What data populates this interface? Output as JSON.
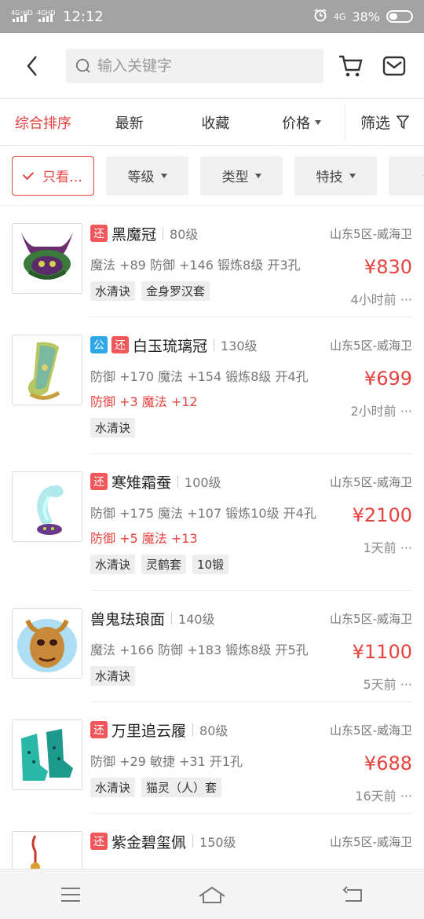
{
  "status": {
    "network": "4G⁺HD 4GHD",
    "time": "12:12",
    "net2": "4G",
    "battery": "38%",
    "battery_level": 0.38
  },
  "search": {
    "placeholder": "输入关键字"
  },
  "sort": {
    "comprehensive": "综合排序",
    "latest": "最新",
    "favorites": "收藏",
    "price": "价格",
    "filter": "筛选"
  },
  "chips": [
    "只看…",
    "等级",
    "类型",
    "特技",
    "特"
  ],
  "items": [
    {
      "tags": [
        "还"
      ],
      "name": "黑魔冠",
      "level": "80级",
      "server": "山东5区-威海卫",
      "stats": "魔法 +89 防御 +146 锻炼8级 开3孔",
      "red": "",
      "price": "¥830",
      "time": "4小时前 ···",
      "labels": [
        "水清诀",
        "金身罗汉套"
      ]
    },
    {
      "tags": [
        "公",
        "还"
      ],
      "name": "白玉琉璃冠",
      "level": "130级",
      "server": "山东5区-威海卫",
      "stats": "防御 +170 魔法 +154 锻炼8级 开4孔",
      "red": "防御 +3 魔法 +12",
      "price": "¥699",
      "time": "2小时前 ···",
      "labels": [
        "水清诀"
      ]
    },
    {
      "tags": [
        "还"
      ],
      "name": "寒雉霜蚕",
      "level": "100级",
      "server": "山东5区-威海卫",
      "stats": "防御 +175 魔法 +107 锻炼10级 开4孔",
      "red": "防御 +5 魔法 +13",
      "price": "¥2100",
      "time": "1天前 ···",
      "labels": [
        "水清诀",
        "灵鹤套",
        "10锻"
      ]
    },
    {
      "tags": [],
      "name": "兽鬼珐琅面",
      "level": "140级",
      "server": "山东5区-威海卫",
      "stats": "魔法 +166 防御 +183 锻炼8级 开5孔",
      "red": "",
      "price": "¥1100",
      "time": "5天前 ···",
      "labels": [
        "水清诀"
      ]
    },
    {
      "tags": [
        "还"
      ],
      "name": "万里追云履",
      "level": "80级",
      "server": "山东5区-威海卫",
      "stats": "防御 +29 敏捷 +31 开1孔",
      "red": "",
      "price": "¥688",
      "time": "16天前 ···",
      "labels": [
        "水清诀",
        "猫灵（人）套"
      ]
    },
    {
      "tags": [
        "还"
      ],
      "name": "紫金碧玺佩",
      "level": "150级",
      "server": "山东5区-威海卫",
      "stats": "",
      "red": "",
      "price": "",
      "time": "",
      "labels": []
    }
  ],
  "colors": {
    "accent": "#e8423f",
    "tag_huan": "#f0565a",
    "tag_gong": "#2fa6e8"
  }
}
